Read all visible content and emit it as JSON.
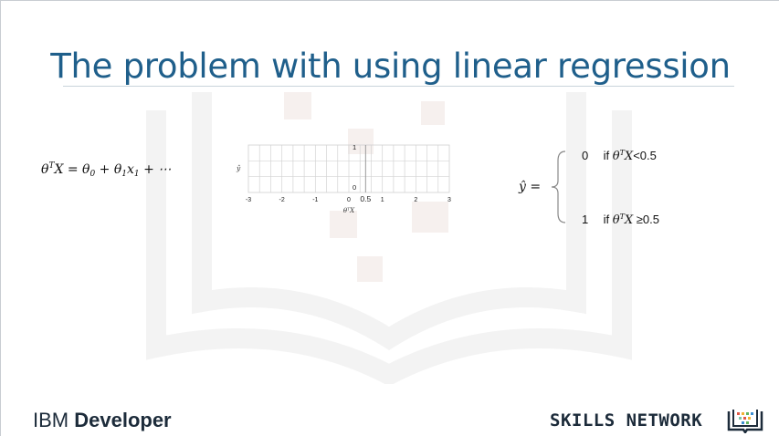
{
  "title": "The problem with using linear regression",
  "equation": {
    "lhs_theta": "θ",
    "lhs_sup": "T",
    "lhs_rest": "X = θ",
    "sub0": "0",
    "plus1": " + θ",
    "sub1a": "1",
    "x": "x",
    "sub1b": "1",
    "tail": " + ⋯"
  },
  "chart_data": {
    "type": "line",
    "title": "",
    "xlabel": "θᵀX",
    "ylabel": "ŷ",
    "x_ticks": [
      "-3",
      "-2",
      "-1",
      "0",
      "0.5",
      "1",
      "2",
      "3"
    ],
    "x_tick_values": [
      -3,
      -2,
      -1,
      0,
      0.5,
      1,
      2,
      3
    ],
    "y_ticks": [
      "0",
      "1"
    ],
    "y_tick_values": [
      0,
      1
    ],
    "xlim": [
      -3,
      3
    ],
    "ylim": [
      0,
      1
    ],
    "grid": true,
    "series": []
  },
  "prediction": {
    "yhat": "ŷ =",
    "case1_value": "0",
    "case1_if": "if",
    "case1_expr_theta": "θ",
    "case1_expr_sup": "T",
    "case1_expr_rest": "X",
    "case1_cond": "<0.5",
    "case2_value": "1",
    "case2_if": "if",
    "case2_expr_theta": "θ",
    "case2_expr_sup": "T",
    "case2_expr_rest": "X",
    "case2_cond": " ≥0.5"
  },
  "footer": {
    "ibm_light": "IBM ",
    "ibm_bold": "Developer",
    "skills_network": "SKILLS NETWORK"
  },
  "colors": {
    "title": "#1f5f8b",
    "grid": "#c8c8c8",
    "footer_text": "#1c2b3a"
  }
}
